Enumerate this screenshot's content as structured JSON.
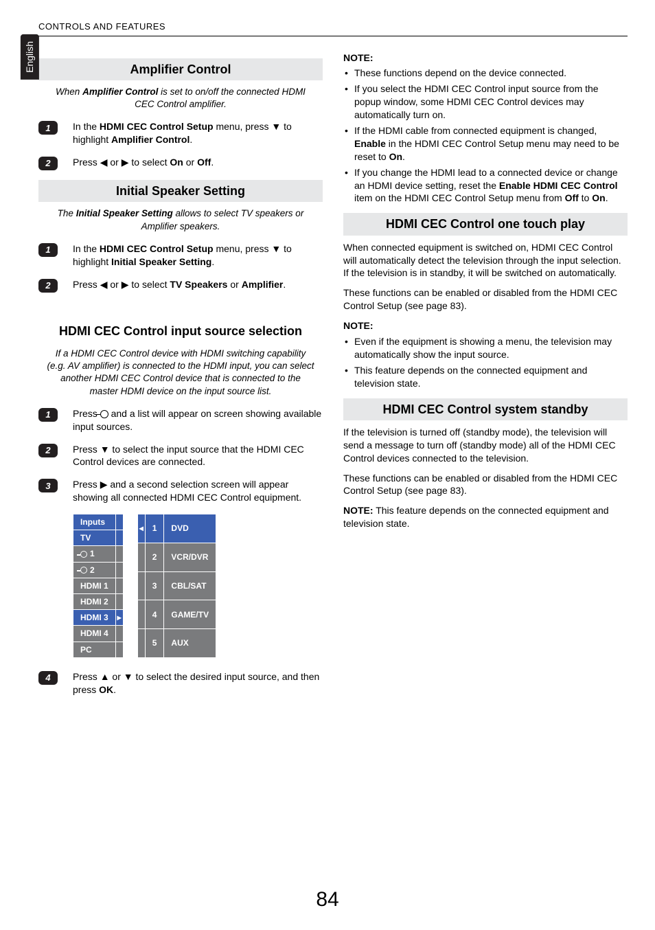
{
  "lang_tab": "English",
  "header": "CONTROLS AND FEATURES",
  "page_number": "84",
  "left": {
    "amp": {
      "title": "Amplifier Control",
      "intro_pre": "When ",
      "intro_b": "Amplifier Control",
      "intro_post": " is set to on/off the connected HDMI CEC Control amplifier.",
      "step1_pre": "In the ",
      "step1_b1": "HDMI CEC Control Setup",
      "step1_mid": " menu, press ",
      "step1_post": " to highlight ",
      "step1_b2": "Amplifier Control",
      "step1_end": ".",
      "step2_pre": "Press ",
      "step2_mid": " or ",
      "step2_post": " to select ",
      "step2_b1": "On",
      "step2_or": " or ",
      "step2_b2": "Off",
      "step2_end": "."
    },
    "speaker": {
      "title": "Initial Speaker Setting",
      "intro_pre": "The ",
      "intro_b": "Initial Speaker Setting",
      "intro_post": " allows to select TV speakers or Amplifier speakers.",
      "step1_pre": "In the ",
      "step1_b1": "HDMI CEC Control Setup",
      "step1_mid": " menu, press ",
      "step1_post": " to highlight ",
      "step1_b2": "Initial Speaker Setting",
      "step1_end": ".",
      "step2_pre": "Press ",
      "step2_mid": " or ",
      "step2_post": " to select ",
      "step2_b1": "TV Speakers",
      "step2_or": " or ",
      "step2_b2": "Amplifier",
      "step2_end": "."
    },
    "src": {
      "title": "HDMI CEC Control input source selection",
      "intro": "If a HDMI CEC Control  device with HDMI switching capability (e.g. AV amplifier) is connected to the HDMI input, you can select another HDMI CEC Control  device that is connected to the master HDMI device on the input source list.",
      "step1_pre": "Press ",
      "step1_post": " and a list will appear on screen showing available input sources.",
      "step2_pre": "Press ",
      "step2_post": " to select the input source that the HDMI CEC Control devices are connected.",
      "step3_pre": "Press ",
      "step3_post": " and a second selection screen will appear showing all connected HDMI CEC Control equipment.",
      "step4_pre": "Press ",
      "step4_mid": " or ",
      "step4_post": " to select the desired input source, and then press ",
      "step4_b": "OK",
      "step4_end": "."
    },
    "inputs_table": {
      "header": "Inputs",
      "rows": [
        "TV",
        "1",
        "2",
        "HDMI 1",
        "HDMI 2",
        "HDMI 3",
        "HDMI 4",
        "PC"
      ]
    },
    "devices_table": {
      "rows": [
        {
          "n": "1",
          "label": "DVD"
        },
        {
          "n": "2",
          "label": "VCR/DVR"
        },
        {
          "n": "3",
          "label": "CBL/SAT"
        },
        {
          "n": "4",
          "label": "GAME/TV"
        },
        {
          "n": "5",
          "label": "AUX"
        }
      ]
    }
  },
  "right": {
    "note_label": "NOTE:",
    "note1": [
      "These functions depend on the device connected.",
      "If you select the HDMI CEC Control input source from the popup window, some HDMI CEC Control devices may automatically turn on."
    ],
    "note1_item3_pre": "If the HDMI cable from connected equipment is changed, ",
    "note1_item3_b1": "Enable",
    "note1_item3_mid": " in the HDMI CEC Control Setup menu may need to be reset to ",
    "note1_item3_b2": "On",
    "note1_item3_end": ".",
    "note1_item4_pre": "If you change the HDMI lead to a connected device or change an HDMI device setting, reset the ",
    "note1_item4_b1": "Enable HDMI CEC Control",
    "note1_item4_mid": " item on the HDMI CEC Control Setup menu from ",
    "note1_item4_b2": "Off",
    "note1_item4_mid2": " to ",
    "note1_item4_b3": "On",
    "note1_item4_end": ".",
    "touch": {
      "title": "HDMI CEC Control one touch play",
      "p1": "When connected equipment is switched on, HDMI CEC Control will automatically detect the television through the input selection. If the television is in standby, it will be switched on automatically.",
      "p2": "These functions can be enabled or disabled from the HDMI CEC Control Setup (see page 83).",
      "note_items": [
        "Even if the equipment is showing a menu, the television may automatically show the input source.",
        "This feature depends on the connected equipment and television state."
      ]
    },
    "standby": {
      "title": "HDMI CEC Control system standby",
      "p1": "If the television is turned off (standby mode), the television will send a message to turn off (standby mode) all of the HDMI CEC Control devices connected to the television.",
      "p2": "These functions can be enabled or disabled from the HDMI CEC Control Setup (see page 83).",
      "p3_b": "NOTE:",
      "p3": " This feature depends on the connected equipment and television state."
    }
  }
}
